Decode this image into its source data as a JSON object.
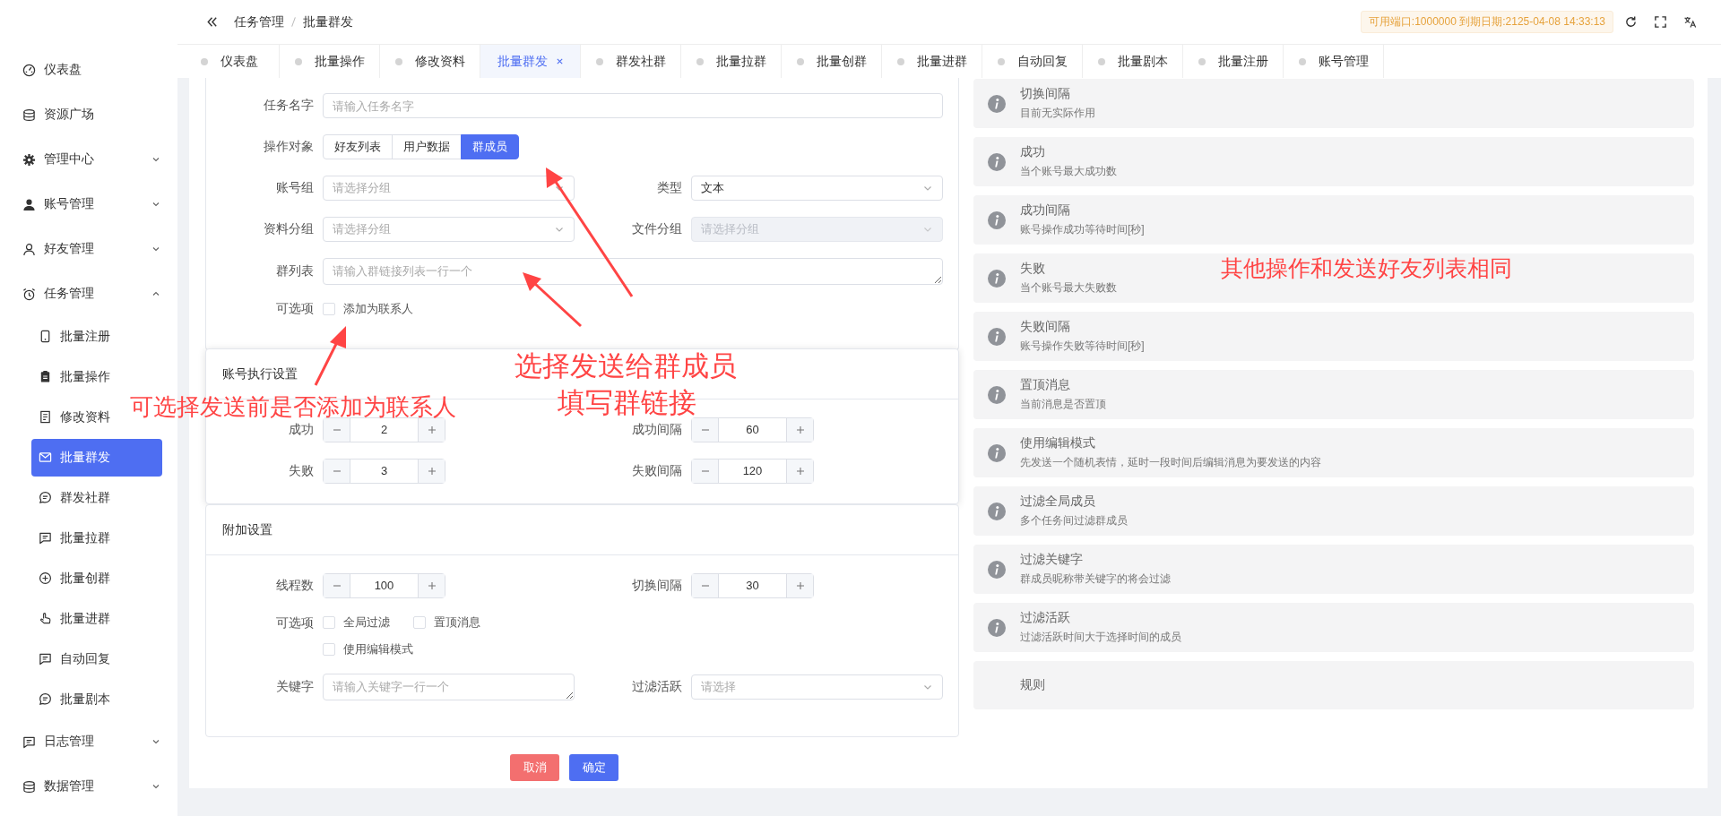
{
  "header": {
    "breadcrumb": [
      "任务管理",
      "批量群发"
    ],
    "license": "可用端口:1000000 到期日期:2125-04-08 14:33:13"
  },
  "sidebar": {
    "items": [
      {
        "label": "仪表盘",
        "selected": false
      },
      {
        "label": "资源广场",
        "selected": false
      },
      {
        "label": "管理中心",
        "selected": false,
        "expanded": false
      },
      {
        "label": "账号管理",
        "selected": false,
        "expanded": false
      },
      {
        "label": "好友管理",
        "selected": false,
        "expanded": false
      },
      {
        "label": "任务管理",
        "selected": false,
        "expanded": true,
        "children": [
          {
            "label": "批量注册",
            "selected": false
          },
          {
            "label": "批量操作",
            "selected": false
          },
          {
            "label": "修改资料",
            "selected": false
          },
          {
            "label": "批量群发",
            "selected": true
          },
          {
            "label": "群发社群",
            "selected": false
          },
          {
            "label": "批量拉群",
            "selected": false
          },
          {
            "label": "批量创群",
            "selected": false
          },
          {
            "label": "批量进群",
            "selected": false
          },
          {
            "label": "自动回复",
            "selected": false
          },
          {
            "label": "批量剧本",
            "selected": false
          }
        ]
      },
      {
        "label": "日志管理",
        "selected": false,
        "expanded": false
      },
      {
        "label": "数据管理",
        "selected": false,
        "expanded": false
      }
    ]
  },
  "tabs": [
    {
      "label": "仪表盘",
      "selected": false
    },
    {
      "label": "批量操作",
      "selected": false
    },
    {
      "label": "修改资料",
      "selected": false
    },
    {
      "label": "批量群发",
      "selected": true
    },
    {
      "label": "群发社群",
      "selected": false
    },
    {
      "label": "批量拉群",
      "selected": false
    },
    {
      "label": "批量创群",
      "selected": false
    },
    {
      "label": "批量进群",
      "selected": false
    },
    {
      "label": "自动回复",
      "selected": false
    },
    {
      "label": "批量剧本",
      "selected": false
    },
    {
      "label": "批量注册",
      "selected": false
    },
    {
      "label": "账号管理",
      "selected": false
    }
  ],
  "task_form": {
    "task_name": {
      "label": "任务名字",
      "placeholder": "请输入任务名字"
    },
    "target": {
      "label": "操作对象",
      "options": [
        {
          "label": "好友列表",
          "selected": false
        },
        {
          "label": "用户数据",
          "selected": false
        },
        {
          "label": "群成员",
          "selected": true
        }
      ]
    },
    "account_group": {
      "label": "账号组",
      "placeholder": "请选择分组",
      "disabled": false
    },
    "type": {
      "label": "类型",
      "value": "文本",
      "disabled": false
    },
    "data_group": {
      "label": "资料分组",
      "placeholder": "请选择分组",
      "disabled": false
    },
    "file_group": {
      "label": "文件分组",
      "placeholder": "请选择分组",
      "disabled": true
    },
    "group_list": {
      "label": "群列表",
      "placeholder": "请输入群链接列表一行一个"
    },
    "options": {
      "label": "可选项",
      "items": [
        {
          "label": "添加为联系人",
          "checked": false
        }
      ]
    }
  },
  "exec_settings": {
    "title": "账号执行设置",
    "steppers": [
      {
        "label": "成功",
        "value": "2"
      },
      {
        "label": "成功间隔",
        "value": "60"
      },
      {
        "label": "失败",
        "value": "3"
      },
      {
        "label": "失败间隔",
        "value": "120"
      }
    ]
  },
  "extra_settings": {
    "title": "附加设置",
    "threads": {
      "label": "线程数",
      "value": "100"
    },
    "switch_interval": {
      "label": "切换间隔",
      "value": "30"
    },
    "options": {
      "label": "可选项",
      "items": [
        {
          "label": "全局过滤",
          "checked": false
        },
        {
          "label": "置顶消息",
          "checked": false
        },
        {
          "label": "使用编辑模式",
          "checked": false
        }
      ]
    },
    "keywords": {
      "label": "关键字",
      "placeholder": "请输入关键字一行一个"
    },
    "filter_active": {
      "label": "过滤活跃",
      "placeholder": "请选择",
      "disabled": false
    }
  },
  "actions": {
    "cancel": "取消",
    "confirm": "确定"
  },
  "help": [
    {
      "title": "切换间隔",
      "description": "目前无实际作用"
    },
    {
      "title": "成功",
      "description": "当个账号最大成功数"
    },
    {
      "title": "成功间隔",
      "description": "账号操作成功等待时间[秒]"
    },
    {
      "title": "失败",
      "description": "当个账号最大失败数"
    },
    {
      "title": "失败间隔",
      "description": "账号操作失败等待时间[秒]"
    },
    {
      "title": "置顶消息",
      "description": "当前消息是否置顶"
    },
    {
      "title": "使用编辑模式",
      "description": "先发送一个随机表情，延时一段时间后编辑消息为要发送的内容"
    },
    {
      "title": "过滤全局成员",
      "description": "多个任务间过滤群成员"
    },
    {
      "title": "过滤关键字",
      "description": "群成员昵称带关键字的将会过滤"
    },
    {
      "title": "过滤活跃",
      "description": "过滤活跃时间大于选择时间的成员"
    },
    {
      "title": "规则"
    }
  ],
  "annotations": [
    "可选择发送前是否添加为联系人",
    "选择发送给群成员",
    "填写群链接",
    "其他操作和发送好友列表相同"
  ]
}
